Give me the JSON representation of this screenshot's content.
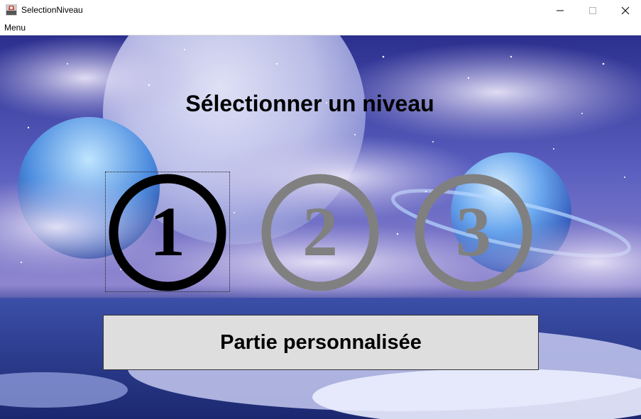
{
  "window": {
    "title": "SelectionNiveau",
    "icon": "java-app-icon",
    "controls": [
      "minimize",
      "maximize",
      "close"
    ]
  },
  "menubar": {
    "items": [
      {
        "label": "Menu"
      }
    ]
  },
  "main": {
    "heading": "Sélectionner un niveau",
    "levels": [
      {
        "label": "1",
        "color": "#000000",
        "selected": true
      },
      {
        "label": "2",
        "color": "#808080",
        "selected": false
      },
      {
        "label": "3",
        "color": "#808080",
        "selected": false
      }
    ],
    "custom_game_label": "Partie personnalisée"
  }
}
